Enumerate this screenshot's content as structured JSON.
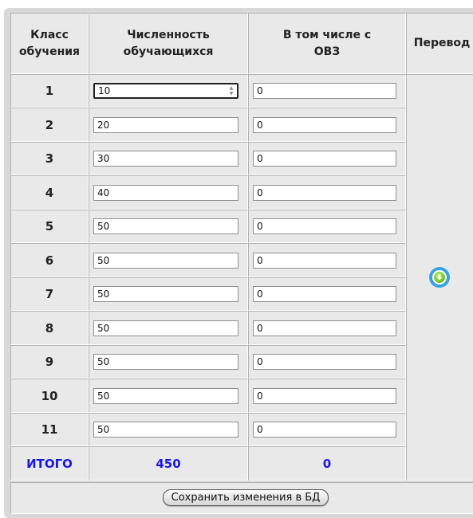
{
  "header": {
    "class_label": "Класс обучения",
    "count_label": "Численность обучающихся",
    "ovz_label": "В том числе с ОВЗ",
    "transfer_label": "Перевод"
  },
  "rows": [
    {
      "grade": "1",
      "count": "10",
      "ovz": "0"
    },
    {
      "grade": "2",
      "count": "20",
      "ovz": "0"
    },
    {
      "grade": "3",
      "count": "30",
      "ovz": "0"
    },
    {
      "grade": "4",
      "count": "40",
      "ovz": "0"
    },
    {
      "grade": "5",
      "count": "50",
      "ovz": "0"
    },
    {
      "grade": "6",
      "count": "50",
      "ovz": "0"
    },
    {
      "grade": "7",
      "count": "50",
      "ovz": "0"
    },
    {
      "grade": "8",
      "count": "50",
      "ovz": "0"
    },
    {
      "grade": "9",
      "count": "50",
      "ovz": "0"
    },
    {
      "grade": "10",
      "count": "50",
      "ovz": "0"
    },
    {
      "grade": "11",
      "count": "50",
      "ovz": "0"
    }
  ],
  "totals": {
    "label": "ИТОГО",
    "count": "450",
    "ovz": "0"
  },
  "transfer_icon": "download-arrow-icon",
  "save_button_label": "Сохранить изменения в БД",
  "colors": {
    "total_text": "#1a1adf",
    "cell_bg": "#e9e9e9",
    "frame_bg": "#d9d9d9",
    "icon_ring": "#39a3e0",
    "icon_core": "#6bc21d"
  }
}
